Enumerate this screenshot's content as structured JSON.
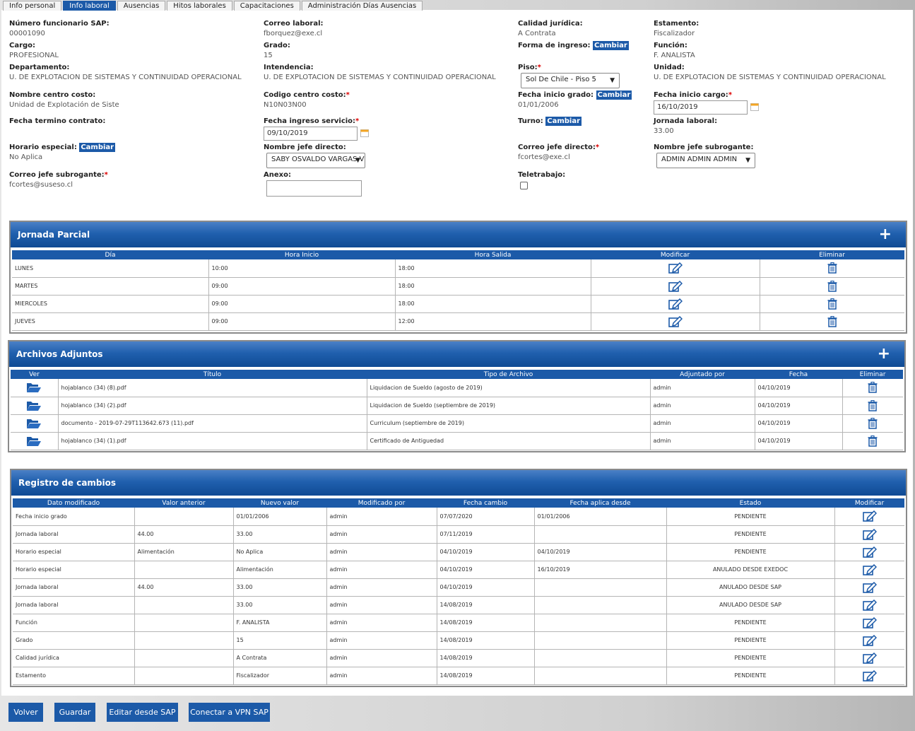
{
  "tabs": [
    "Info personal",
    "Info laboral",
    "Ausencias",
    "Hitos laborales",
    "Capacitaciones",
    "Administración Días Ausencias"
  ],
  "fields": {
    "numero_sap": {
      "label": "Número funcionario SAP:",
      "value": "00001090"
    },
    "cargo": {
      "label": "Cargo:",
      "value": "PROFESIONAL"
    },
    "departamento": {
      "label": "Departamento:",
      "value": "U. DE EXPLOTACION DE SISTEMAS Y CONTINUIDAD OPERACIONAL"
    },
    "centro_costo": {
      "label": "Nombre centro costo:",
      "value": "Unidad de Explotación de Siste"
    },
    "termino": {
      "label": "Fecha termino contrato:"
    },
    "horario": {
      "label": "Horario especial:",
      "value": "No Aplica"
    },
    "correo_sub": {
      "label": "Correo jefe subrogante:",
      "value": "fcortes@suseso.cl"
    },
    "correo": {
      "label": "Correo laboral:",
      "value": "fborquez@exe.cl"
    },
    "grado": {
      "label": "Grado:",
      "value": "15"
    },
    "intendencia": {
      "label": "Intendencia:",
      "value": "U. DE EXPLOTACION DE SISTEMAS Y CONTINUIDAD OPERACIONAL"
    },
    "codigo_cc": {
      "label": "Codigo centro costo:",
      "value": "N10N03N00"
    },
    "ingreso": {
      "label": "Fecha ingreso servicio:",
      "value": "09/10/2019"
    },
    "jefe": {
      "label": "Nombre jefe directo:",
      "value": "SABY OSVALDO VARGAS V"
    },
    "anexo": {
      "label": "Anexo:"
    },
    "calidad": {
      "label": "Calidad jurídica:",
      "value": "A Contrata"
    },
    "forma": {
      "label": "Forma de ingreso:"
    },
    "piso": {
      "label": "Piso:",
      "value": "Sol De Chile - Piso 5"
    },
    "inicio_grado": {
      "label": "Fecha inicio grado:",
      "value": "01/01/2006"
    },
    "turno": {
      "label": "Turno:"
    },
    "correo_jefe": {
      "label": "Correo jefe directo:",
      "value": "fcortes@exe.cl"
    },
    "teletrabajo": {
      "label": "Teletrabajo:"
    },
    "estamento": {
      "label": "Estamento:",
      "value": "Fiscalizador"
    },
    "funcion": {
      "label": "Función:",
      "value": "F. ANALISTA"
    },
    "unidad": {
      "label": "Unidad:",
      "value": "U. DE EXPLOTACION DE SISTEMAS Y CONTINUIDAD OPERACIONAL"
    },
    "inicio_cargo": {
      "label": "Fecha inicio cargo:",
      "value": "16/10/2019"
    },
    "jornada": {
      "label": "Jornada laboral:",
      "value": "33.00"
    },
    "jefe_sub": {
      "label": "Nombre jefe subrogante:",
      "value": "ADMIN ADMIN ADMIN"
    }
  },
  "cambiar": "Cambiar",
  "required_mark": "*",
  "jornada_parcial": {
    "title": "Jornada Parcial",
    "headers": [
      "Día",
      "Hora Inicio",
      "Hora Salida",
      "Modificar",
      "Eliminar"
    ],
    "rows": [
      [
        "LUNES",
        "10:00",
        "18:00"
      ],
      [
        "MARTES",
        "09:00",
        "18:00"
      ],
      [
        "MIERCOLES",
        "09:00",
        "18:00"
      ],
      [
        "JUEVES",
        "09:00",
        "12:00"
      ]
    ]
  },
  "archivos": {
    "title": "Archivos Adjuntos",
    "headers": [
      "Ver",
      "Título",
      "Tipo de Archivo",
      "Adjuntado por",
      "Fecha",
      "Eliminar"
    ],
    "rows": [
      [
        "hojablanco (34) (8).pdf",
        "Liquidacion de Sueldo (agosto de 2019)",
        "admin",
        "04/10/2019"
      ],
      [
        "hojablanco (34) (2).pdf",
        "Liquidacion de Sueldo (septiembre de 2019)",
        "admin",
        "04/10/2019"
      ],
      [
        "documento - 2019-07-29T113642.673 (11).pdf",
        "Curriculum (septiembre de 2019)",
        "admin",
        "04/10/2019"
      ],
      [
        "hojablanco (34) (1).pdf",
        "Certificado de Antiguedad",
        "admin",
        "04/10/2019"
      ]
    ]
  },
  "registro": {
    "title": "Registro de cambios",
    "headers": [
      "Dato modificado",
      "Valor anterior",
      "Nuevo valor",
      "Modificado por",
      "Fecha cambio",
      "Fecha aplica desde",
      "Estado",
      "Modificar"
    ],
    "rows": [
      [
        "Fecha inicio grado",
        "",
        "01/01/2006",
        "admin",
        "07/07/2020",
        "01/01/2006",
        "PENDIENTE"
      ],
      [
        "Jornada laboral",
        "44.00",
        "33.00",
        "admin",
        "07/11/2019",
        "",
        "PENDIENTE"
      ],
      [
        "Horario especial",
        "Alimentación",
        "No Aplica",
        "admin",
        "04/10/2019",
        "04/10/2019",
        "PENDIENTE"
      ],
      [
        "Horario especial",
        "",
        "Alimentación",
        "admin",
        "04/10/2019",
        "16/10/2019",
        "ANULADO DESDE EXEDOC"
      ],
      [
        "Jornada laboral",
        "44.00",
        "33.00",
        "admin",
        "04/10/2019",
        "",
        "ANULADO DESDE SAP"
      ],
      [
        "Jornada laboral",
        "",
        "33.00",
        "admin",
        "14/08/2019",
        "",
        "ANULADO DESDE SAP"
      ],
      [
        "Función",
        "",
        "F. ANALISTA",
        "admin",
        "14/08/2019",
        "",
        "PENDIENTE"
      ],
      [
        "Grado",
        "",
        "15",
        "admin",
        "14/08/2019",
        "",
        "PENDIENTE"
      ],
      [
        "Calidad jurídica",
        "",
        "A Contrata",
        "admin",
        "14/08/2019",
        "",
        "PENDIENTE"
      ],
      [
        "Estamento",
        "",
        "Fiscalizador",
        "admin",
        "14/08/2019",
        "",
        "PENDIENTE"
      ]
    ]
  },
  "buttons": {
    "volver": "Volver",
    "guardar": "Guardar",
    "editar_sap": "Editar desde SAP",
    "vpn": "Conectar a VPN SAP"
  }
}
